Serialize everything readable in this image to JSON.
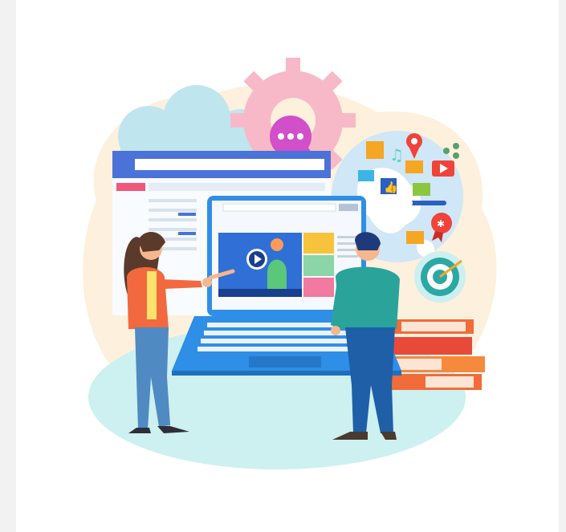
{
  "illustration": {
    "subject": "online-learning-video-illustration",
    "colors": {
      "background": "#f2f2f2",
      "panel": "#ffffff",
      "blob_peach": "#fdf0dc",
      "floor_mint": "#cdf0f0",
      "laptop_blue": "#2f8ee6",
      "browser_blue": "#4a72d9",
      "gear_pink": "#f7b9c8",
      "cloud_cyan": "#bfe6ef",
      "books_orange": "#f26b3a"
    },
    "icons": [
      "cloud-icon",
      "gear-icon",
      "chat-bubble-icon",
      "globe-icon",
      "play-button-icon",
      "target-icon",
      "thumbs-up-icon",
      "envelope-icon",
      "location-pin-icon",
      "share-icon",
      "music-note-icon"
    ]
  }
}
